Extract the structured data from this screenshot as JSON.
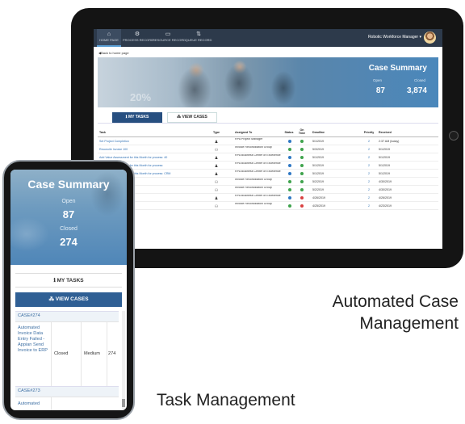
{
  "tablet": {
    "nav": {
      "items": [
        {
          "label": "HOME PAGE",
          "icon": "home-icon",
          "glyph": "⌂"
        },
        {
          "label": "PROCESS RECORD",
          "icon": "process-icon",
          "glyph": "⚙"
        },
        {
          "label": "RESOURCE RECORD",
          "icon": "monitor-icon",
          "glyph": "▭"
        },
        {
          "label": "QUEUE RECORD",
          "icon": "queue-icon",
          "glyph": "⇅"
        }
      ],
      "user_label": "Robotic Workforce Manager ▾"
    },
    "back_link": "◀Back to home page",
    "summary": {
      "title": "Case Summary",
      "open_label": "Open",
      "open_value": "87",
      "closed_label": "Closed",
      "closed_value": "3,874",
      "photo_text": "20%"
    },
    "tabs": {
      "my_tasks": "ℹ MY TASKS",
      "view_cases": "⁂ VIEW CASES"
    },
    "table": {
      "headers": [
        "Task",
        "Type",
        "Assigned To",
        "Status",
        "On Time",
        "Deadline",
        "Priority",
        "Received"
      ],
      "rows": [
        {
          "task": "Set Project Completion",
          "type": "person",
          "assigned": "RPA Project Manager",
          "status": "blue",
          "ontime": "ok",
          "deadline": "5/1/2019",
          "priority": "2",
          "received": "2:37 AM (today)"
        },
        {
          "task": "Reconcile Invoice 100",
          "type": "group",
          "assigned": "Invoice Reconciliation Group",
          "status": "green",
          "ontime": "ok",
          "deadline": "5/3/2019",
          "priority": "2",
          "received": "5/1/2019"
        },
        {
          "task": "Add Value Assessment for this Month for process: 40",
          "type": "person",
          "assigned": "RPA Business Center of Excellence",
          "status": "blue",
          "ontime": "ok",
          "deadline": "5/1/2019",
          "priority": "2",
          "received": "5/1/2019"
        },
        {
          "task": "Add Value Assessment for this Month for process:",
          "type": "person",
          "assigned": "RPA Business Center of Excellence",
          "status": "blue",
          "ontime": "ok",
          "deadline": "5/1/2019",
          "priority": "2",
          "received": "5/1/2019"
        },
        {
          "task": "Add Value Assessment for this Month for process: CRM",
          "type": "person",
          "assigned": "RPA Business Center of Excellence",
          "status": "blue",
          "ontime": "ok",
          "deadline": "5/1/2019",
          "priority": "2",
          "received": "5/1/2019"
        },
        {
          "task": "",
          "type": "group",
          "assigned": "Invoice Reconciliation Group",
          "status": "green",
          "ontime": "ok",
          "deadline": "5/2/2019",
          "priority": "2",
          "received": "4/30/2019"
        },
        {
          "task": "",
          "type": "group",
          "assigned": "Invoice Reconciliation Group",
          "status": "green",
          "ontime": "ok",
          "deadline": "5/2/2019",
          "priority": "2",
          "received": "4/30/2019"
        },
        {
          "task": "",
          "type": "person",
          "assigned": "RPA Business Center of Excellence",
          "status": "blue",
          "ontime": "late",
          "deadline": "4/26/2019",
          "priority": "2",
          "received": "4/26/2019"
        },
        {
          "task": "",
          "type": "group",
          "assigned": "Invoice Reconciliation Group",
          "status": "green",
          "ontime": "late",
          "deadline": "4/25/2019",
          "priority": "2",
          "received": "4/23/2019"
        }
      ]
    }
  },
  "phone": {
    "summary": {
      "title": "Case Summary",
      "open_label": "Open",
      "open_value": "87",
      "closed_label": "Closed",
      "closed_value": "274"
    },
    "my_tasks": "ℹ MY TASKS",
    "view_cases": "⁂ VIEW CASES",
    "cases": [
      {
        "id": "CASE#274",
        "description": "Automated Invoice Data Entry Failed - Appian Send Invoice to ERP",
        "status": "Closed",
        "priority": "Medium",
        "number": "274"
      },
      {
        "id": "CASE#273",
        "description": "Automated",
        "status": "",
        "priority": "",
        "number": ""
      }
    ]
  },
  "captions": {
    "acm_line1": "Automated Case",
    "acm_line2": "Management",
    "task_management": "Task Management"
  }
}
